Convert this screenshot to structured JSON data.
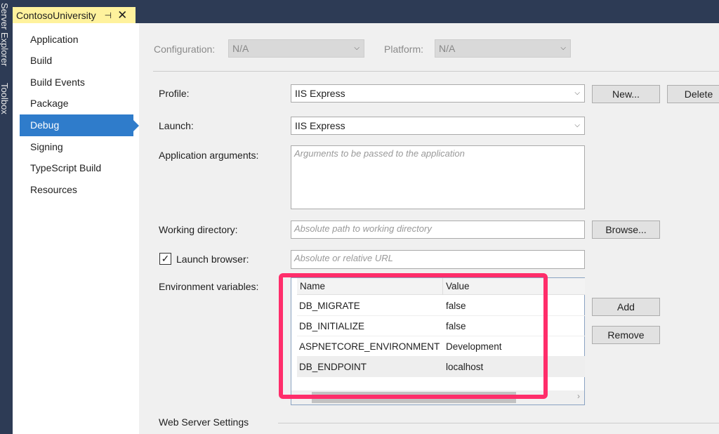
{
  "side_strip": [
    "Server Explorer",
    "Toolbox"
  ],
  "tab": {
    "title": "ContosoUniversity",
    "pin_icon": "pin-icon",
    "close_icon": "close-icon"
  },
  "nav": [
    "Application",
    "Build",
    "Build Events",
    "Package",
    "Debug",
    "Signing",
    "TypeScript Build",
    "Resources"
  ],
  "nav_active": "Debug",
  "config": {
    "configuration_label": "Configuration:",
    "configuration_value": "N/A",
    "platform_label": "Platform:",
    "platform_value": "N/A"
  },
  "profile": {
    "label": "Profile:",
    "value": "IIS Express",
    "new_label": "New...",
    "delete_label": "Delete"
  },
  "launch": {
    "label": "Launch:",
    "value": "IIS Express"
  },
  "app_args": {
    "label": "Application arguments:",
    "placeholder": "Arguments to be passed to the application"
  },
  "working_dir": {
    "label": "Working directory:",
    "placeholder": "Absolute path to working directory",
    "browse_label": "Browse..."
  },
  "launch_browser": {
    "label": "Launch browser:",
    "checked": true,
    "placeholder": "Absolute or relative URL"
  },
  "env": {
    "label": "Environment variables:",
    "columns": [
      "Name",
      "Value"
    ],
    "rows": [
      [
        "DB_MIGRATE",
        "false"
      ],
      [
        "DB_INITIALIZE",
        "false"
      ],
      [
        "ASPNETCORE_ENVIRONMENT",
        "Development"
      ],
      [
        "DB_ENDPOINT",
        "localhost"
      ]
    ],
    "add_label": "Add",
    "remove_label": "Remove"
  },
  "web_server": {
    "label": "Web Server Settings"
  },
  "highlight_color": "#ff2d6a"
}
